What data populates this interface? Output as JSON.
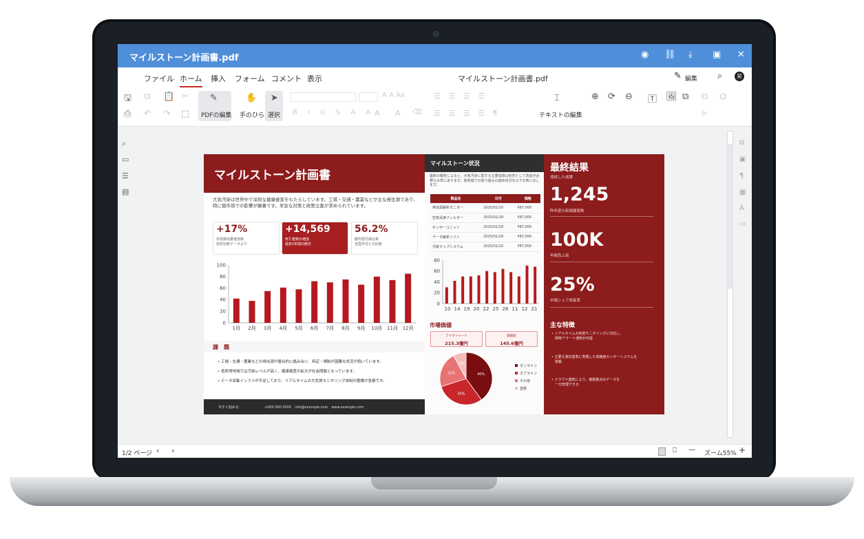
{
  "app": {
    "title": "マイルストーン計画書.pdf",
    "doc_title": "マイルストーン計画書.pdf",
    "edit_label": "編集",
    "avatar": "契"
  },
  "menu": [
    "ファイル",
    "ホーム",
    "挿入",
    "フォーム",
    "コメント",
    "表示"
  ],
  "ribbon": {
    "pdf_edit": "PDFの編集",
    "hand": "手のひら",
    "select": "選択",
    "text_edit": "テキストの編集",
    "font_symbols": "A A Aa",
    "format_symbols": "B I U S A A"
  },
  "status": {
    "page": "1/2 ページ",
    "zoom": "ズーム55%"
  },
  "doc": {
    "title": "マイルストーン計画書",
    "intro": "大気汚染は世界中で深刻な健康被害をもたらしています。工場・交通・農業などが主な発生源であり、特に都市部での影響が顕著です。早急な対策と政策立案が求められています。",
    "kpis": [
      {
        "value": "+17%",
        "sub": "年間排出量増加率\n前年比較データより"
      },
      {
        "value": "+14,569",
        "sub": "死亡者数の増加\n過去5年間の統計"
      },
      {
        "value": "56.2%",
        "sub": "都市部汚染比率\n全国平均との比較"
      }
    ],
    "issues_title": "課　題",
    "issues": [
      "• 工場・交通・農業などの排出源が複合的に絡み合い、特定・規制が困難な状況が続いています。",
      "• 低所得地域では汚染レベルが高く、健康格差の拡大が社会問題となっています。",
      "• データ収集インフラが不足しており、リアルタイムの大気質モニタリング体制の整備が急務です。"
    ],
    "footer": {
      "cta": "今すぐ始める",
      "contact": "+000 000 0000　info@example.com　www.example.com"
    },
    "status_title": "マイルストーン状況",
    "status_text": "最新の報告によると、大気汚染に関する主要指標は依然として改善が必要な水準にあります。各地域での取り組みの進捗状況を以下の表に示します。",
    "table": {
      "headers": [
        "製品名",
        "日付",
        "価格"
      ],
      "rows": [
        [
          "排出源解析モニター",
          "2025/01/10",
          "¥87,000"
        ],
        [
          "空気清浄フィルター",
          "2025/01/18",
          "¥87,000"
        ],
        [
          "センサーユニット",
          "2025/01/18",
          "¥87,000"
        ],
        [
          "データ解析ソフト",
          "2025/01/18",
          "¥87,000"
        ],
        [
          "汚染マップシステム",
          "2025/01/10",
          "¥87,000"
        ]
      ]
    },
    "market_title": "市場価値",
    "market": [
      {
        "name": "ファクトシート",
        "value": "215.3億円"
      },
      {
        "name": "調査結",
        "value": "145.6億円"
      }
    ],
    "results_title": "最終結果",
    "results_sub": "達成した成果",
    "results": [
      {
        "value": "1,245",
        "label": "昨年度の新規顧客数"
      },
      {
        "value": "100K",
        "label": "年間売上高"
      },
      {
        "value": "25%",
        "label": "市場シェア成長率"
      }
    ],
    "features_title": "主な特徴",
    "features": [
      "• リアルタイム大気質モニタリングに対応し、\n　即時アラート通知が可能",
      "• 主要な測定基準に準拠した高精度センサーシステムを\n　搭載",
      "• クラウド連携により、複数拠点のデータを\n　一元管理できる"
    ]
  },
  "chart_data": [
    {
      "type": "bar",
      "categories": [
        "1月",
        "2月",
        "3月",
        "4月",
        "5月",
        "6月",
        "7月",
        "8月",
        "9月",
        "10月",
        "11月",
        "12月"
      ],
      "values": [
        42,
        38,
        55,
        61,
        58,
        72,
        70,
        75,
        66,
        80,
        74,
        85
      ],
      "ylim": [
        0,
        100
      ],
      "yticks": [
        0,
        20,
        40,
        60,
        80,
        100
      ],
      "color": "#b5191f",
      "grid": false
    },
    {
      "type": "bar",
      "categories": [
        "10",
        "",
        "14",
        "",
        "19",
        "",
        "20",
        "",
        "22",
        "",
        "25",
        "",
        "26",
        "",
        "11",
        "",
        "12",
        ""
      ],
      "values": [
        30,
        42,
        50,
        50,
        52,
        60,
        58,
        64,
        58,
        50,
        70,
        68
      ],
      "ylim": [
        0,
        80
      ],
      "yticks": [
        0,
        20,
        40,
        60,
        80
      ],
      "xticks": [
        "10",
        "14",
        "19",
        "20",
        "22",
        "25",
        "26",
        "11",
        "12",
        "21"
      ],
      "color": "#b5191f",
      "grid": false
    },
    {
      "type": "pie",
      "labels": [
        "オンライン",
        "オフライン",
        "その他",
        "直販"
      ],
      "values": [
        40,
        30,
        22,
        8
      ],
      "slice_labels": [
        "40%",
        "30%",
        "22%",
        "8%"
      ],
      "colors": [
        "#7a0d10",
        "#c8262b",
        "#e87373",
        "#f5bcbc"
      ]
    }
  ]
}
